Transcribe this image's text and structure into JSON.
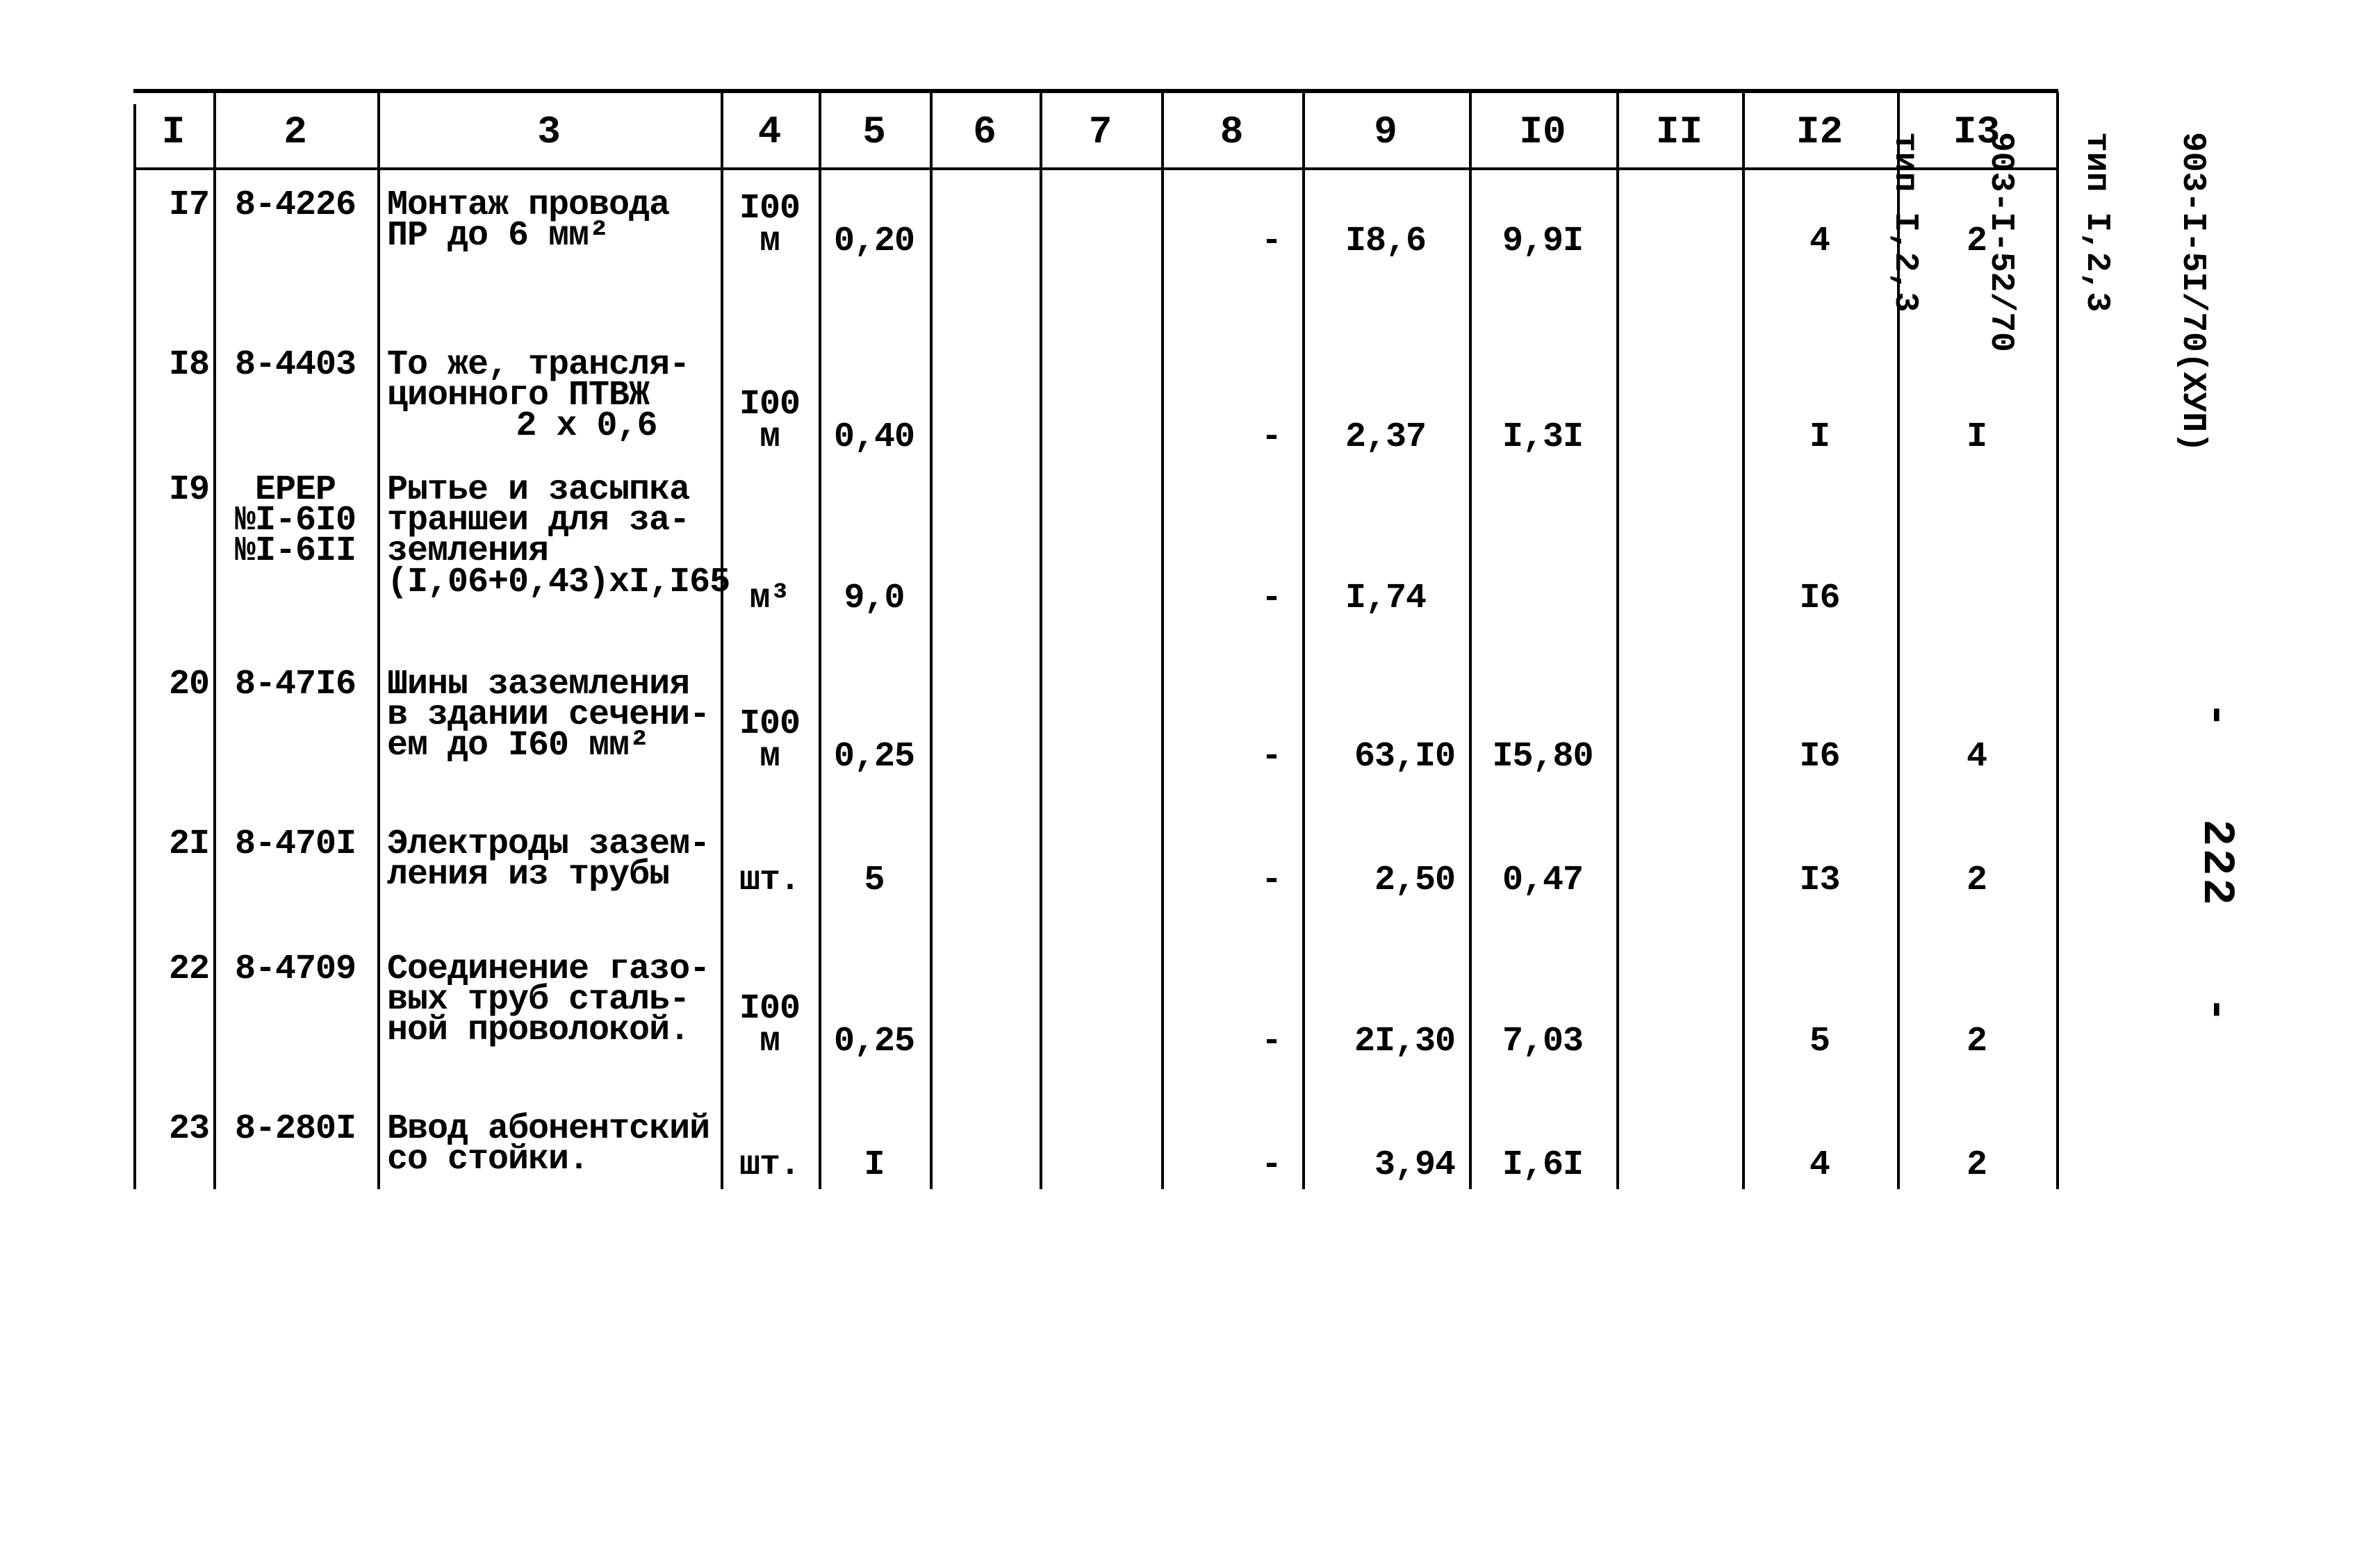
{
  "table": {
    "headers": [
      "I",
      "2",
      "3",
      "4",
      "5",
      "6",
      "7",
      "8",
      "9",
      "I0",
      "II",
      "I2",
      "I3"
    ],
    "rows": [
      {
        "n": "I7",
        "code": [
          "8-4226"
        ],
        "desc": [
          "Монтаж провода",
          "ПР до 6 мм²"
        ],
        "unit": [
          "I00",
          "м"
        ],
        "qty": "0,20",
        "c6": "",
        "c7": "",
        "c8": "-",
        "c9": "I8,6",
        "c10": "9,9I",
        "c11": "",
        "c12": "4",
        "c13": "2"
      },
      {
        "n": "I8",
        "code": [
          "8-4403"
        ],
        "desc": [
          "То же, трансля-",
          "ционного ПТВЖ",
          "2 х 0,6"
        ],
        "unit": [
          "I00",
          "м"
        ],
        "qty": "0,40",
        "c6": "",
        "c7": "",
        "c8": "-",
        "c9": "2,37",
        "c10": "I,3I",
        "c11": "",
        "c12": "I",
        "c13": "I"
      },
      {
        "n": "I9",
        "code": [
          "ЕРЕР",
          "№I-6I0",
          "№I-6II"
        ],
        "desc": [
          "Рытье и засыпка",
          "траншеи для за-",
          "земления",
          "(I,06+0,43)хI,I65"
        ],
        "unit": [
          "м³"
        ],
        "qty": "9,0",
        "c6": "",
        "c7": "",
        "c8": "-",
        "c9": "I,74",
        "c10": "",
        "c11": "",
        "c12": "I6",
        "c13": ""
      },
      {
        "n": "20",
        "code": [
          "8-47I6"
        ],
        "desc": [
          "Шины заземления",
          "в здании сечени-",
          "ем до I60 мм²"
        ],
        "unit": [
          "I00",
          "м"
        ],
        "qty": "0,25",
        "c6": "",
        "c7": "",
        "c8": "-",
        "c9": "63,I0",
        "c10": "I5,80",
        "c11": "",
        "c12": "I6",
        "c13": "4"
      },
      {
        "n": "2I",
        "code": [
          "8-470I"
        ],
        "desc": [
          "Электроды зазем-",
          "ления из трубы"
        ],
        "unit": [
          "шт."
        ],
        "qty": "5",
        "c6": "",
        "c7": "",
        "c8": "-",
        "c9": "2,50",
        "c10": "0,47",
        "c11": "",
        "c12": "I3",
        "c13": "2"
      },
      {
        "n": "22",
        "code": [
          "8-4709"
        ],
        "desc": [
          "Соединение газо-",
          "вых труб сталь-",
          "ной проволокой."
        ],
        "unit": [
          "I00",
          "м"
        ],
        "qty": "0,25",
        "c6": "",
        "c7": "",
        "c8": "-",
        "c9": "2I,30",
        "c10": "7,03",
        "c11": "",
        "c12": "5",
        "c13": "2"
      },
      {
        "n": "23",
        "code": [
          "8-280I"
        ],
        "desc": [
          "Ввод абонентский",
          "со стойки."
        ],
        "unit": [
          "шт."
        ],
        "qty": "I",
        "c6": "",
        "c7": "",
        "c8": "-",
        "c9": "3,94",
        "c10": "I,6I",
        "c11": "",
        "c12": "4",
        "c13": "2"
      }
    ]
  },
  "side_stamp": {
    "lines": [
      "903-I-5I/70(XУП)",
      "тип I,2,3",
      "903-I-52/70",
      "тип I,2,3"
    ]
  },
  "page_number": "-   222   -"
}
